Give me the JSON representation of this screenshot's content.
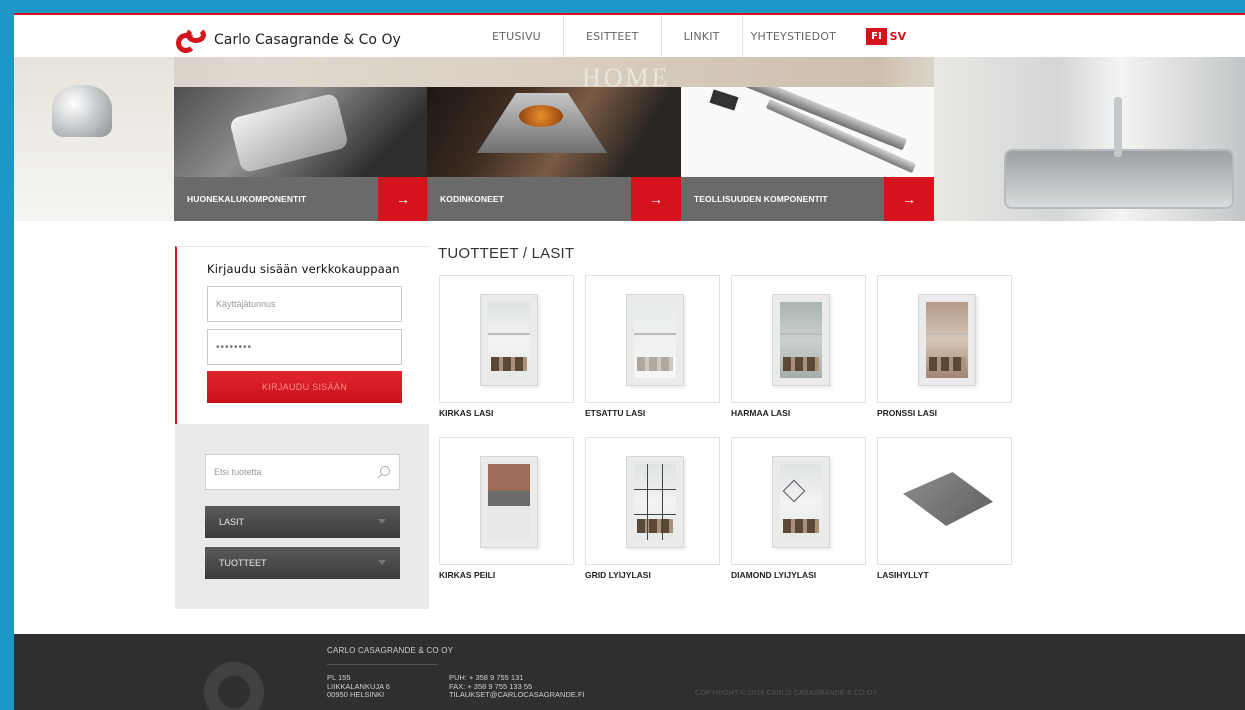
{
  "header": {
    "logo_text": "Carlo Casagrande & Co Oy",
    "nav": [
      "ETUSIVU",
      "ESITTEET",
      "LINKIT",
      "YHTEYSTIEDOT"
    ],
    "lang_fi": "FI",
    "lang_sv": "SV"
  },
  "hero": {
    "word": "HOME",
    "tiles": [
      {
        "label": "HUONEKALUKOMPONENTIT",
        "arrow": "→"
      },
      {
        "label": "KODINKONEET",
        "arrow": "→"
      },
      {
        "label": "TEOLLISUUDEN KOMPONENTIT",
        "arrow": "→"
      }
    ]
  },
  "login": {
    "title": "Kirjaudu sisään verkkokauppaan",
    "username_placeholder": "Käyttäjätunnus",
    "password_value": "••••••••",
    "button": "KIRJAUDU SISÄÄN"
  },
  "search": {
    "placeholder": "Etsi tuotetta",
    "dropdowns": [
      "LASIT",
      "TUOTTEET"
    ]
  },
  "content": {
    "title": "TUOTTEET / LASIT",
    "products": [
      {
        "label": "KIRKAS LASI"
      },
      {
        "label": "ETSATTU LASI"
      },
      {
        "label": "HARMAA LASI"
      },
      {
        "label": "PRONSSI LASI"
      },
      {
        "label": "KIRKAS PEILI"
      },
      {
        "label": "GRID LYIJYLASI"
      },
      {
        "label": "DIAMOND LYIJYLASI"
      },
      {
        "label": "LASIHYLLYT"
      }
    ]
  },
  "footer": {
    "company": "CARLO CASAGRANDE & CO OY",
    "address": [
      "PL 155",
      "LIIKKALANKUJA 6",
      "00950 HELSINKI"
    ],
    "contact": [
      "PUH: + 358 9 755 131",
      "FAX: + 358 9 755 133 55",
      "TILAUKSET@CARLOCASAGRANDE.FI"
    ],
    "copyright": "COPYRIGHT © 2016 CARLO CASAGRANDE & CO OY"
  },
  "colors": {
    "accent": "#d4131c",
    "footer_bg": "#2f2f2f",
    "page_bg": "#1e96c8"
  }
}
